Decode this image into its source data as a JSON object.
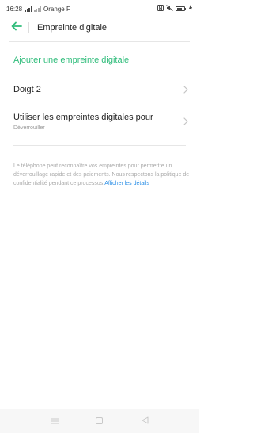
{
  "status_bar": {
    "time": "16:28",
    "carrier": "Orange F"
  },
  "header": {
    "title": "Empreinte digitale"
  },
  "main": {
    "add_label": "Ajouter une empreinte digitale",
    "fingerprint_item": "Doigt 2",
    "use_for_title": "Utiliser les empreintes digitales pour",
    "use_for_value": "Déverrouiller",
    "info_text": "Le téléphone peut reconnaître vos empreintes pour permettre un déverrouillage rapide et des paiements. Nous respectons la politique de confidentialité pendant ce processus.",
    "info_link": "Afficher les détails"
  },
  "colors": {
    "accent": "#2ebc7a",
    "link": "#2a8ee6"
  },
  "icons": {
    "back": "arrow-left-icon",
    "chevron": "chevron-right-icon",
    "nav_menu": "menu-icon",
    "nav_home": "square-icon",
    "nav_back": "triangle-back-icon"
  }
}
